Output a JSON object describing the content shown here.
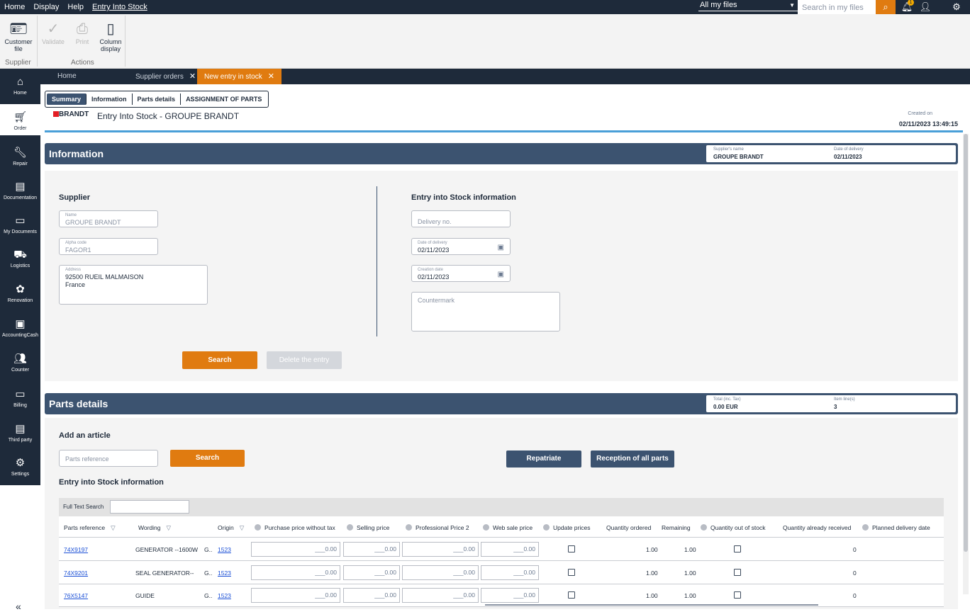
{
  "topbar": {
    "menu": [
      "Home",
      "Display",
      "Help",
      "Entry Into Stock"
    ],
    "files_select": "All my files",
    "search_placeholder": "Search in my files",
    "notification_count": "1"
  },
  "ribbon": {
    "customer_file": "Customer file",
    "validate": "Validate",
    "print": "Print",
    "column_display": "Column display",
    "group_supplier": "Supplier",
    "group_actions": "Actions"
  },
  "sidebar": {
    "items": [
      "Home",
      "Order",
      "Repair",
      "Documentation",
      "My Documents",
      "Logistics",
      "Renovation",
      "AccountingCash",
      "Counter",
      "Billing",
      "Third party",
      "Settings"
    ]
  },
  "tabs": [
    "Home",
    "Supplier orders",
    "New entry in stock"
  ],
  "subtabs": [
    "Summary",
    "Information",
    "Parts details",
    "ASSIGNMENT OF PARTS"
  ],
  "header": {
    "logo": "BRANDT",
    "title": "Entry Into Stock -  GROUPE BRANDT",
    "created_label": "Created on",
    "created_value": "02/11/2023 13:49:15"
  },
  "information": {
    "title": "Information",
    "supplier_name_label": "Supplier's name",
    "supplier_name": "GROUPE BRANDT",
    "delivery_date_label": "Date of delivery",
    "delivery_date": "02/11/2023",
    "supplier_section": "Supplier",
    "name_label": "Name",
    "name_value": "GROUPE BRANDT",
    "alpha_label": "Alpha code",
    "alpha_value": "FAGOR1",
    "address_label": "Address",
    "address_line1": "92500 RUEIL MALMAISON",
    "address_line2": "France",
    "entry_section": "Entry into Stock information",
    "delivery_no_placeholder": "Delivery no.",
    "date_delivery_label": "Date of delivery",
    "date_delivery_value": "02/11/2023",
    "creation_date_label": "Creation date",
    "creation_date_value": "02/11/2023",
    "countermark_placeholder": "Countermark",
    "search_button": "Search",
    "delete_button": "Delete the entry"
  },
  "parts": {
    "title": "Parts details",
    "total_label": "Total (inc. Tax)",
    "total_value": "0.00 EUR",
    "lines_label": "Item line(s)",
    "lines_value": "3",
    "add_article": "Add an article",
    "parts_ref_placeholder": "Parts reference",
    "search_button": "Search",
    "repatriate_button": "Repatriate",
    "reception_button": "Reception of all parts",
    "entry_info": "Entry into Stock information",
    "full_text_search": "Full Text Search"
  },
  "grid": {
    "columns": [
      "Parts reference",
      "Wording",
      "Origin",
      "Purchase price without tax",
      "Selling price",
      "Professional Price 2",
      "Web sale price",
      "Update prices",
      "Quantity ordered",
      "Remaining",
      "Quantity out of stock",
      "Quantity already received",
      "Planned delivery date"
    ],
    "rows": [
      {
        "ref": "74X9197",
        "wording": "GENERATOR --1600W",
        "g": "G..",
        "origin": "1523",
        "purchase": "___0.00",
        "selling": "___0.00",
        "pro": "___0.00",
        "web": "___0.00",
        "ordered": "1.00",
        "remaining": "1.00",
        "received": "0"
      },
      {
        "ref": "74X9201",
        "wording": "SEAL GENERATOR--",
        "g": "G..",
        "origin": "1523",
        "purchase": "___0.00",
        "selling": "___0.00",
        "pro": "___0.00",
        "web": "___0.00",
        "ordered": "1.00",
        "remaining": "1.00",
        "received": "0"
      },
      {
        "ref": "76X5147",
        "wording": "GUIDE",
        "g": "G..",
        "origin": "1523",
        "purchase": "___0.00",
        "selling": "___0.00",
        "pro": "___0.00",
        "web": "___0.00",
        "ordered": "1.00",
        "remaining": "1.00",
        "received": "0"
      }
    ]
  }
}
